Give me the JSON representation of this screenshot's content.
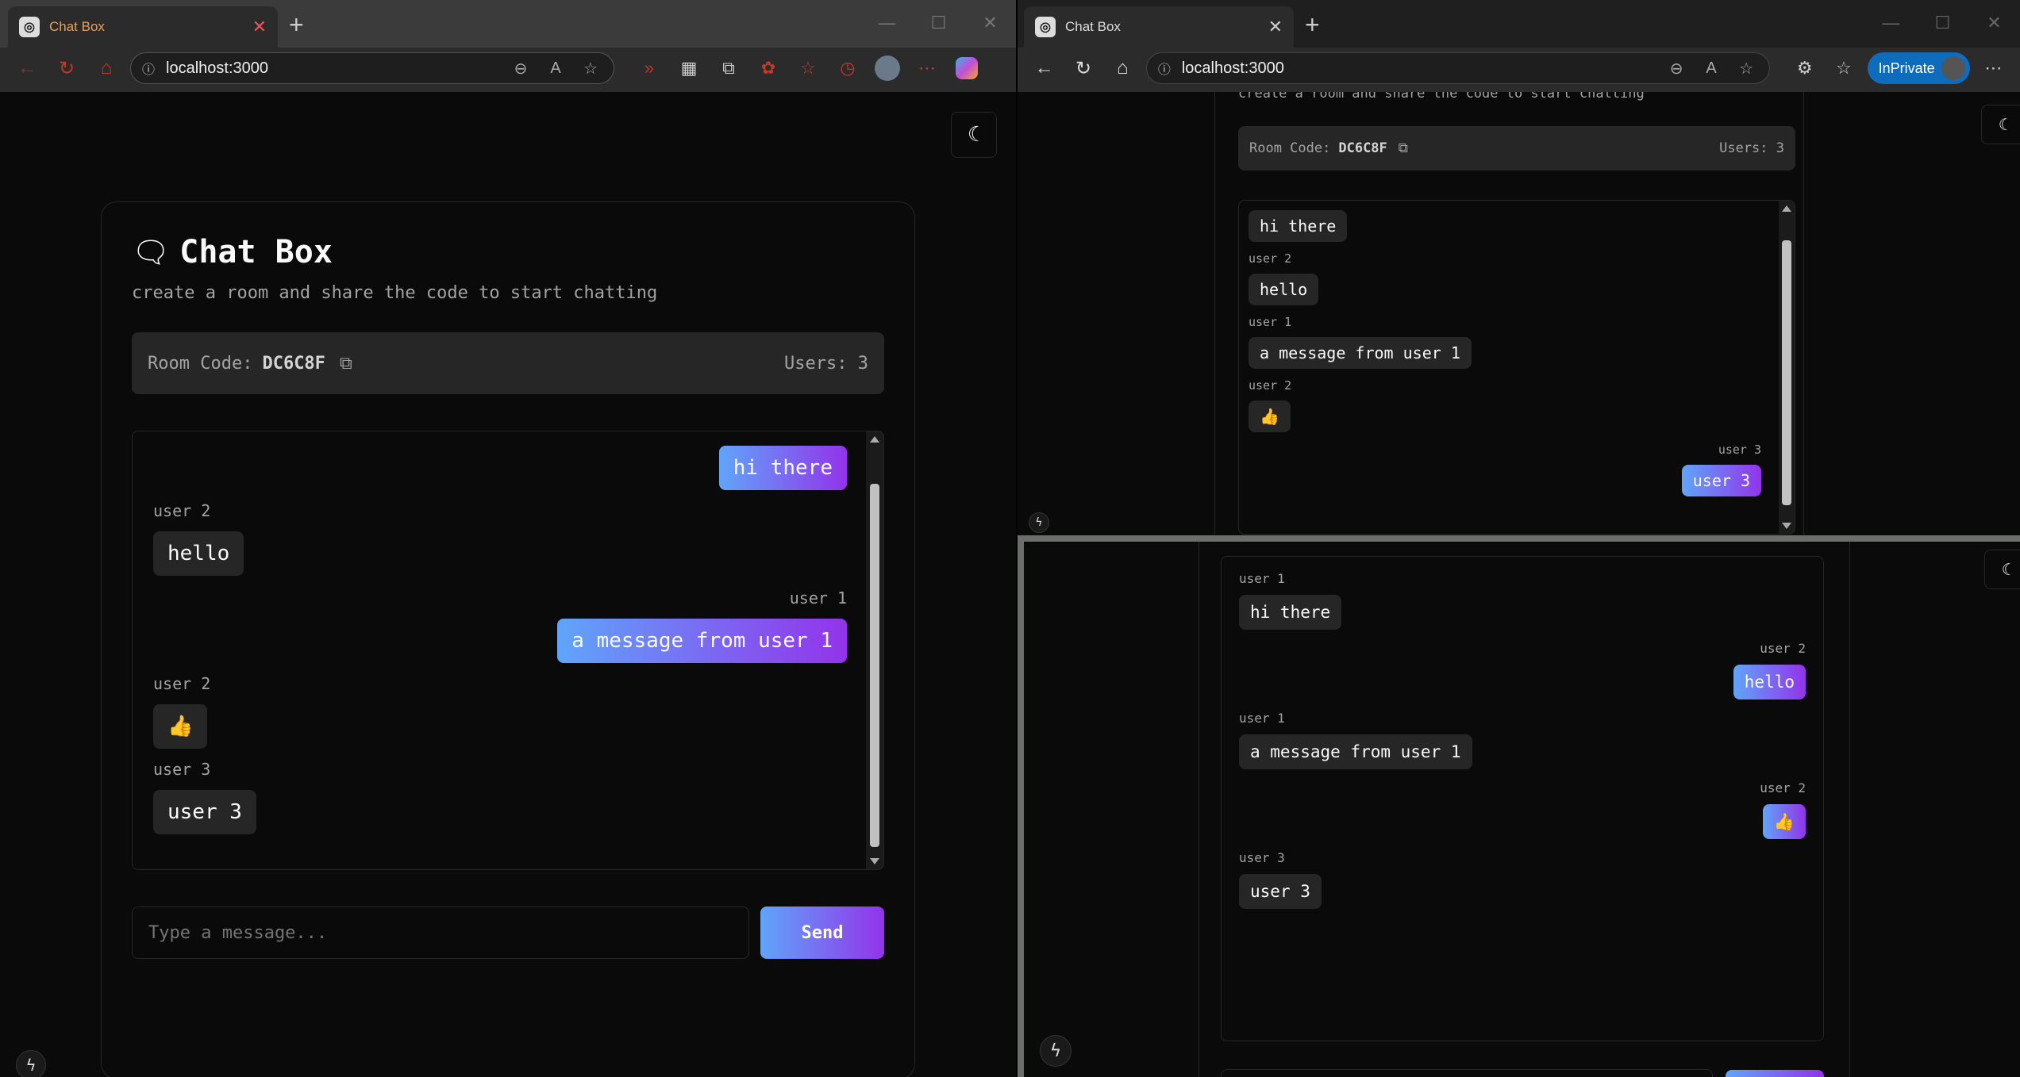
{
  "browser_left": {
    "tab_title": "Chat Box",
    "url": "localhost:3000",
    "window_controls": [
      "—",
      "☐",
      "✕"
    ]
  },
  "browser_right": {
    "tab_title": "Chat Box",
    "url": "localhost:3000",
    "inprivate_label": "InPrivate"
  },
  "app": {
    "title": "Chat Box",
    "subtitle": "create a room and share the code to start chatting",
    "room_label": "Room Code:",
    "room_code": "DC6C8F",
    "users_label": "Users: 3",
    "input_placeholder": "Type a message...",
    "send_label": "Send",
    "subtitle_partial": "create a room and share the code to start chatting"
  },
  "left_messages": [
    {
      "user": "",
      "text": "hi there",
      "own": true
    },
    {
      "user": "user 2",
      "text": "hello",
      "own": false
    },
    {
      "user": "user 1",
      "text": "a message from user 1",
      "own": true
    },
    {
      "user": "user 2",
      "text": "👍",
      "own": false
    },
    {
      "user": "user 3",
      "text": "user 3",
      "own": false
    }
  ],
  "right_top_messages": [
    {
      "user": "",
      "text": "hi there",
      "own": false
    },
    {
      "user": "user 2",
      "text": "hello",
      "own": false
    },
    {
      "user": "user 1",
      "text": "a message from user 1",
      "own": false
    },
    {
      "user": "user 2",
      "text": "👍",
      "own": false
    },
    {
      "user": "user 3",
      "text": "user 3",
      "own": true
    }
  ],
  "right_bottom_messages": [
    {
      "user": "user 1",
      "text": "hi there",
      "own": false
    },
    {
      "user": "user 2",
      "text": "hello",
      "own": true
    },
    {
      "user": "user 1",
      "text": "a message from user 1",
      "own": false
    },
    {
      "user": "user 2",
      "text": "👍",
      "own": true
    },
    {
      "user": "user 3",
      "text": "user 3",
      "own": false
    }
  ],
  "colors": {
    "bg": "#0a0a0a",
    "card_border": "#262626",
    "bubble_grey": "#262626",
    "grad_start": "#60a5fa",
    "grad_end": "#9333ea",
    "inprivate": "#0f6cbd"
  }
}
